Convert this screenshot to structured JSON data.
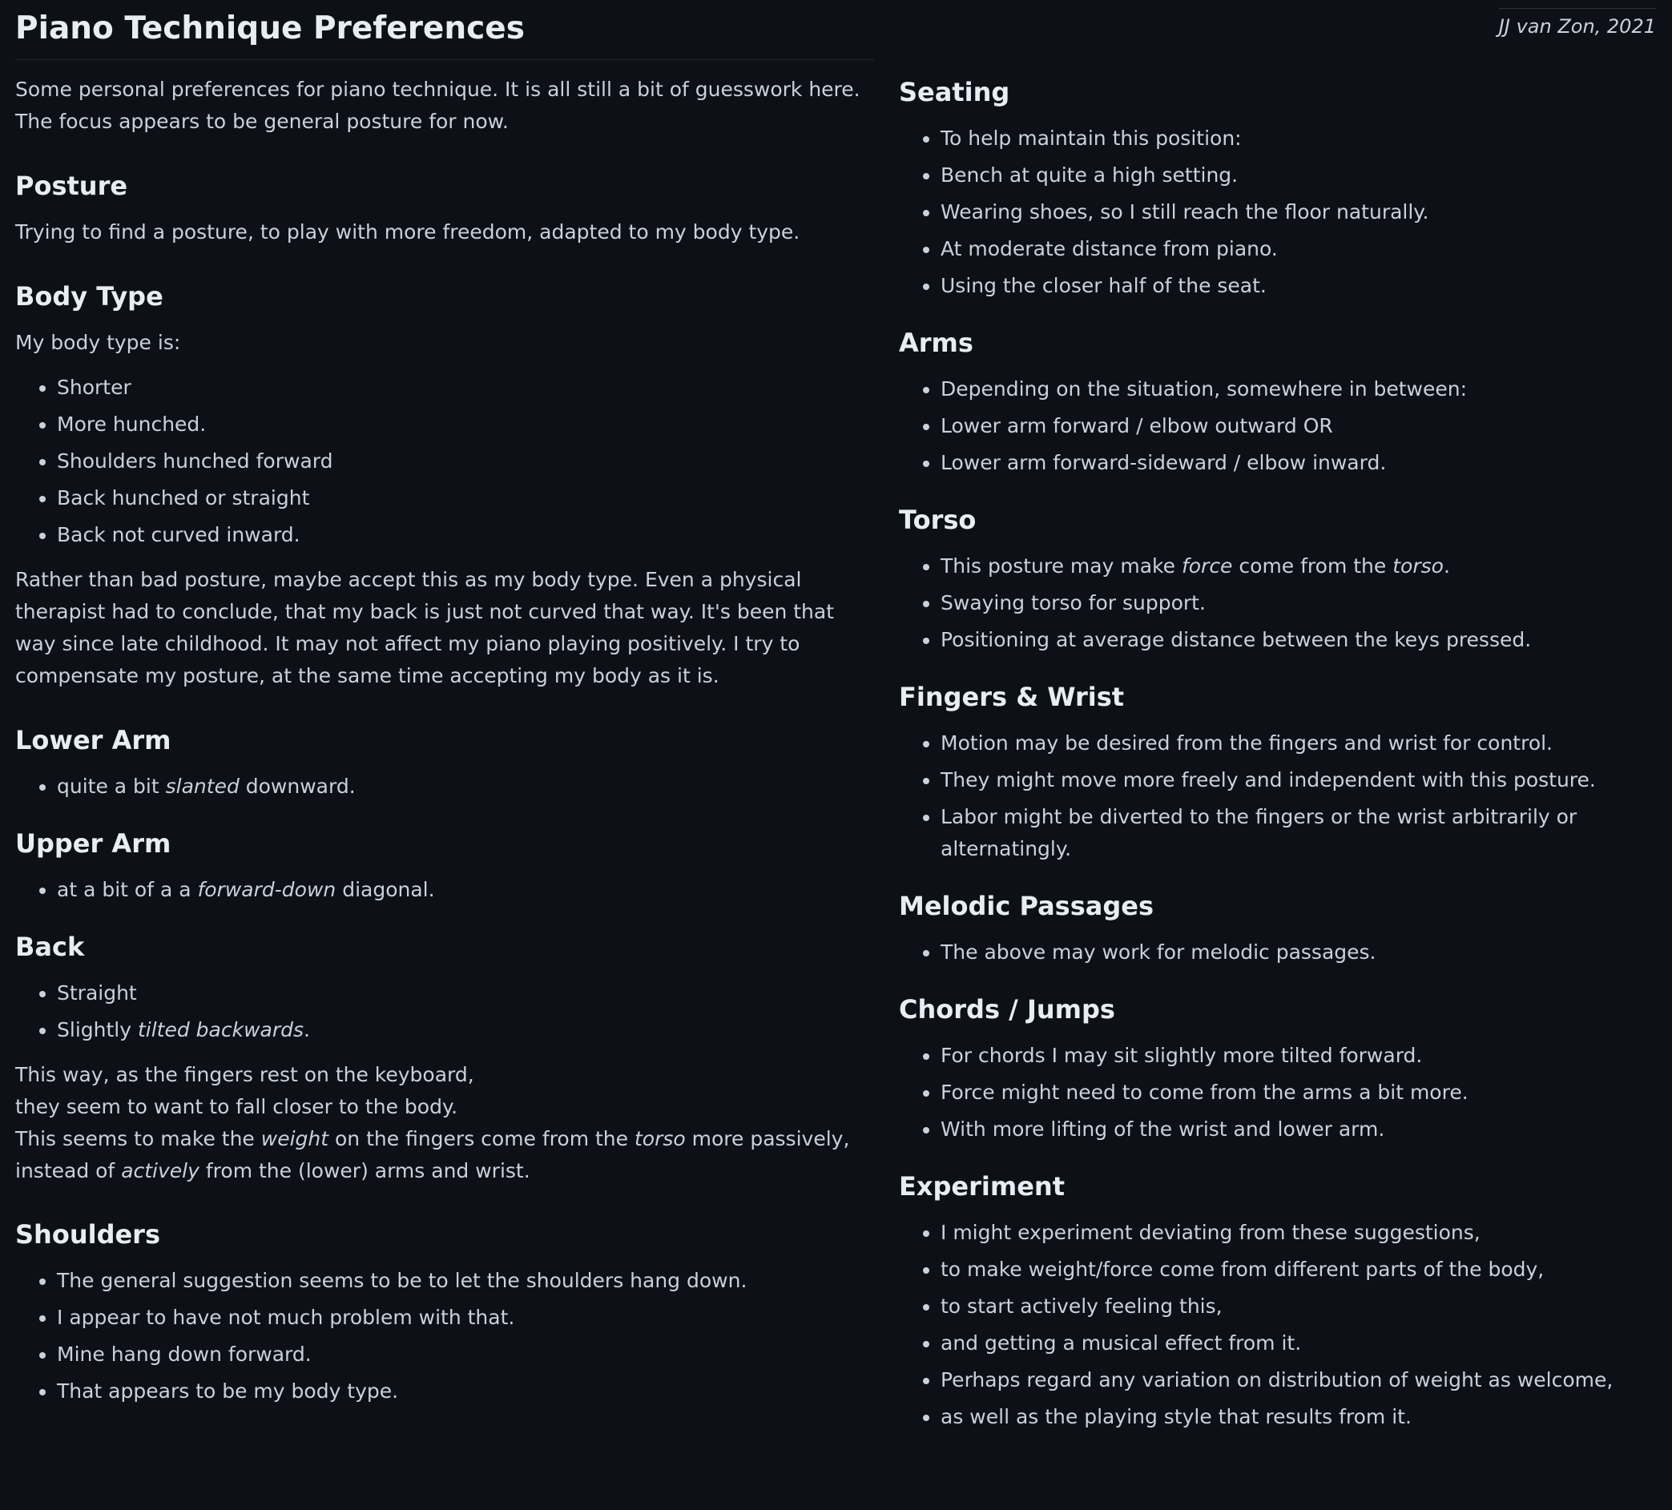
{
  "author": "JJ van Zon, 2021",
  "title": "Piano Technique Preferences",
  "intro": "Some personal preferences for piano technique. It is all still a bit of guesswork here. The focus appears to be general posture for now.",
  "posture": {
    "heading": "Posture",
    "text": "Trying to find a posture, to play with more freedom, adapted to my body type."
  },
  "body_type": {
    "heading": "Body Type",
    "lead": "My body type is:",
    "items": [
      "Shorter",
      "More hunched.",
      "Shoulders hunched forward",
      "Back hunched or straight",
      "Back not curved inward."
    ],
    "para": "Rather than bad posture, maybe accept this as my body type. Even a physical therapist had to conclude, that my back is just not curved that way. It's been that way since late childhood. It may not affect my piano playing positively. I try to compensate my posture, at the same time accepting my body as it is."
  },
  "lower_arm": {
    "heading": "Lower Arm",
    "pre": "quite a bit ",
    "em": "slanted",
    "post": " downward."
  },
  "upper_arm": {
    "heading": "Upper Arm",
    "pre": "at a bit of a a ",
    "em": "forward-down",
    "post": " diagonal."
  },
  "back": {
    "heading": "Back",
    "item1": "Straight",
    "item2_pre": "Slightly ",
    "item2_em": "tilted backwards",
    "item2_post": ".",
    "line1": "This way, as the fingers rest on the keyboard,",
    "line2": "they seem to want to fall closer to the body.",
    "line3_a": "This seems to make the ",
    "line3_em1": "weight",
    "line3_b": " on the fingers come from the ",
    "line3_em2": "torso",
    "line3_c": " more passively,",
    "line4_a": "instead of ",
    "line4_em": "actively",
    "line4_b": " from the (lower) arms and wrist."
  },
  "shoulders": {
    "heading": "Shoulders",
    "items": [
      "The general suggestion seems to be to let the shoulders hang down.",
      "I appear to have not much problem with that.",
      "Mine hang down forward.",
      "That appears to be my body type."
    ]
  },
  "seating": {
    "heading": "Seating",
    "items": [
      "To help maintain this position:",
      "Bench at quite a high setting.",
      "Wearing shoes, so I still reach the floor naturally.",
      "At moderate distance from piano.",
      "Using the closer half of the seat."
    ]
  },
  "arms": {
    "heading": "Arms",
    "items": [
      "Depending on the situation, somewhere in between:",
      "Lower arm forward / elbow outward OR",
      "Lower arm forward-sideward / elbow inward."
    ]
  },
  "torso": {
    "heading": "Torso",
    "item1_a": "This posture may make ",
    "item1_em1": "force",
    "item1_b": " come from the ",
    "item1_em2": "torso",
    "item1_c": ".",
    "items": [
      "Swaying torso for support.",
      "Positioning at average distance between the keys pressed."
    ]
  },
  "fingers_wrist": {
    "heading": "Fingers & Wrist",
    "items": [
      "Motion may be desired from the fingers and wrist for control.",
      "They might move more freely and independent with this posture.",
      "Labor might be diverted to the fingers or the wrist arbitrarily or alternatingly."
    ]
  },
  "melodic": {
    "heading": "Melodic Passages",
    "items": [
      "The above may work for melodic passages."
    ]
  },
  "chords": {
    "heading": "Chords / Jumps",
    "items": [
      "For chords I may sit slightly more tilted forward.",
      "Force might need to come from the arms a bit more.",
      "With more lifting of the wrist and lower arm."
    ]
  },
  "experiment": {
    "heading": "Experiment",
    "items": [
      "I might experiment deviating from these suggestions,",
      "to make weight/force come from different parts of the body,",
      "to start actively feeling this,",
      "and getting a musical effect from it.",
      "Perhaps regard any variation on distribution of weight as welcome,",
      "as well as the playing style that results from it."
    ]
  }
}
